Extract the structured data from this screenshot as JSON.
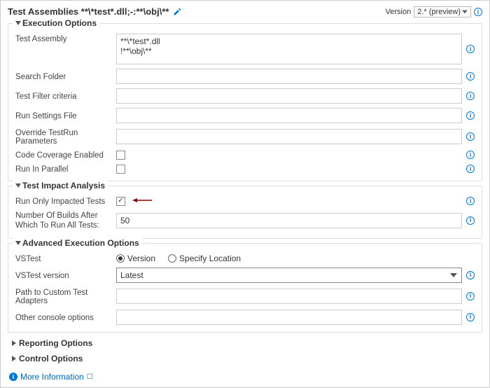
{
  "header": {
    "title": "Test Assemblies **\\*test*.dll;-:**\\obj\\**",
    "versionLabel": "Version",
    "versionValue": "2.* (preview)"
  },
  "sections": {
    "execution": {
      "title": "Execution Options",
      "testAssembly": {
        "label": "Test Assembly",
        "value": "**\\*test*.dll\n!**\\obj\\**"
      },
      "searchFolder": {
        "label": "Search Folder",
        "value": ""
      },
      "testFilter": {
        "label": "Test Filter criteria",
        "value": ""
      },
      "runSettings": {
        "label": "Run Settings File",
        "value": ""
      },
      "overrideParams": {
        "label": "Override TestRun Parameters",
        "value": ""
      },
      "codeCoverage": {
        "label": "Code Coverage Enabled",
        "checked": false
      },
      "runParallel": {
        "label": "Run In Parallel",
        "checked": false
      }
    },
    "testImpact": {
      "title": "Test Impact Analysis",
      "runImpacted": {
        "label": "Run Only Impacted Tests",
        "checked": true
      },
      "numBuilds": {
        "label": "Number Of Builds After Which To Run All Tests:",
        "value": "50"
      }
    },
    "advanced": {
      "title": "Advanced Execution Options",
      "vstest": {
        "label": "VSTest",
        "options": {
          "version": "Version",
          "specify": "Specify Location"
        },
        "selected": "version"
      },
      "vstestVersion": {
        "label": "VSTest version",
        "value": "Latest"
      },
      "customAdapters": {
        "label": "Path to Custom Test Adapters",
        "value": ""
      },
      "consoleOptions": {
        "label": "Other console options",
        "value": ""
      }
    },
    "reporting": {
      "title": "Reporting Options"
    },
    "control": {
      "title": "Control Options"
    }
  },
  "footer": {
    "moreInfo": "More Information"
  }
}
